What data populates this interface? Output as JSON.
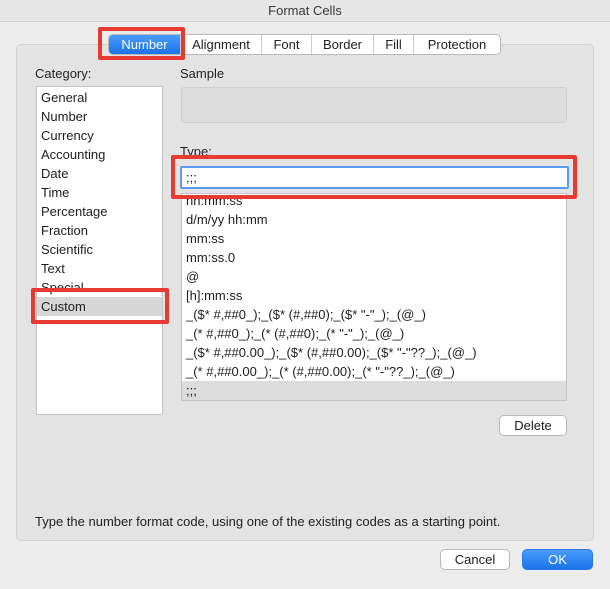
{
  "window": {
    "title": "Format Cells"
  },
  "tabs": [
    {
      "label": "Number",
      "active": true
    },
    {
      "label": "Alignment"
    },
    {
      "label": "Font"
    },
    {
      "label": "Border"
    },
    {
      "label": "Fill"
    },
    {
      "label": "Protection"
    }
  ],
  "category": {
    "label": "Category:",
    "items": [
      "General",
      "Number",
      "Currency",
      "Accounting",
      "Date",
      "Time",
      "Percentage",
      "Fraction",
      "Scientific",
      "Text",
      "Special",
      "Custom"
    ],
    "selected": "Custom"
  },
  "sample": {
    "label": "Sample"
  },
  "type": {
    "label": "Type:",
    "value": ";;;",
    "list": [
      "hh:mm:ss",
      "d/m/yy hh:mm",
      "mm:ss",
      "mm:ss.0",
      "@",
      "[h]:mm:ss",
      "_($* #,##0_);_($* (#,##0);_($* \"-\"_);_(@_)",
      "_(* #,##0_);_(* (#,##0);_(* \"-\"_);_(@_)",
      "_($* #,##0.00_);_($* (#,##0.00);_($* \"-\"??_);_(@_)",
      "_(* #,##0.00_);_(* (#,##0.00);_(* \"-\"??_);_(@_)",
      ";;;"
    ]
  },
  "buttons": {
    "delete": "Delete",
    "cancel": "Cancel",
    "ok": "OK"
  },
  "hint": "Type the number format code, using one of the existing codes as a starting point.",
  "colors": {
    "accent": "#1a73e8",
    "highlight": "#e63a33"
  }
}
